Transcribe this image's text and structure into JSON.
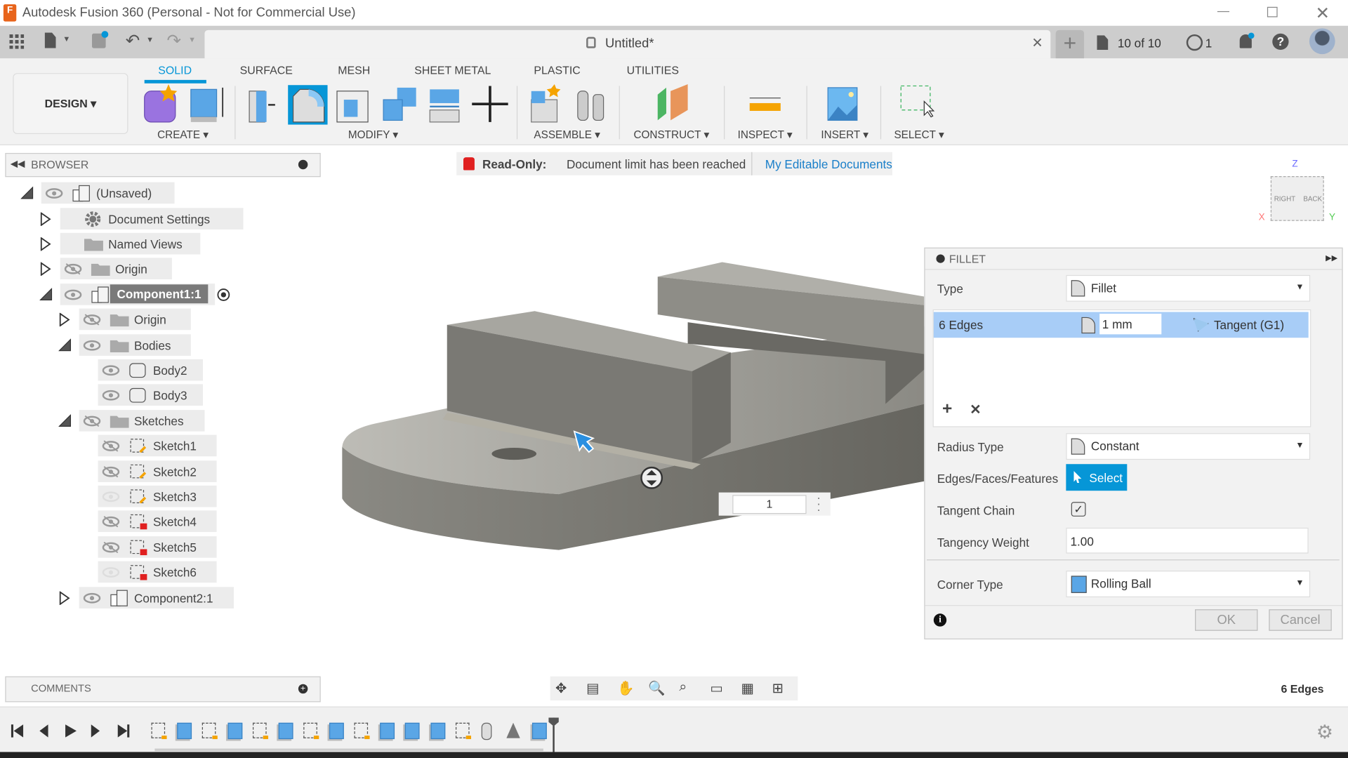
{
  "app": {
    "title": "Autodesk Fusion 360 (Personal - Not for Commercial Use)",
    "logo_letter": "F"
  },
  "window_controls": [
    "minimize",
    "restore",
    "close"
  ],
  "doc_tab": {
    "title": "Untitled*",
    "lock_icon": "lock-icon"
  },
  "header_right": {
    "job_count": "10 of 10",
    "clock_count": "1",
    "accent": "#0696d7"
  },
  "workspace": {
    "label": "DESIGN ▾"
  },
  "ribbon_tabs": [
    {
      "label": "SOLID",
      "active": true
    },
    {
      "label": "SURFACE"
    },
    {
      "label": "MESH"
    },
    {
      "label": "SHEET METAL"
    },
    {
      "label": "PLASTIC"
    },
    {
      "label": "UTILITIES"
    }
  ],
  "ribbon_groups": [
    {
      "label": "CREATE ▾"
    },
    {
      "label": "MODIFY ▾"
    },
    {
      "label": "ASSEMBLE ▾"
    },
    {
      "label": "CONSTRUCT ▾"
    },
    {
      "label": "INSPECT ▾"
    },
    {
      "label": "INSERT ▾"
    },
    {
      "label": "SELECT ▾"
    }
  ],
  "browser": {
    "title": "BROWSER",
    "items": [
      {
        "label": "(Unsaved)",
        "level": 0,
        "expand": "open",
        "eye": "on",
        "icon": "component"
      },
      {
        "label": "Document Settings",
        "level": 1,
        "expand": "closed",
        "eye": "none",
        "icon": "gear"
      },
      {
        "label": "Named Views",
        "level": 1,
        "expand": "closed",
        "eye": "none",
        "icon": "folder"
      },
      {
        "label": "Origin",
        "level": 1,
        "expand": "closed",
        "eye": "off",
        "icon": "folder"
      },
      {
        "label": "Component1:1",
        "level": 1,
        "expand": "open",
        "eye": "on",
        "icon": "component",
        "highlighted": true,
        "active": true
      },
      {
        "label": "Origin",
        "level": 2,
        "expand": "closed",
        "eye": "off",
        "icon": "folder"
      },
      {
        "label": "Bodies",
        "level": 2,
        "expand": "open",
        "eye": "on",
        "icon": "folder"
      },
      {
        "label": "Body2",
        "level": 3,
        "expand": "none",
        "eye": "on",
        "icon": "body"
      },
      {
        "label": "Body3",
        "level": 3,
        "expand": "none",
        "eye": "on",
        "icon": "body"
      },
      {
        "label": "Sketches",
        "level": 2,
        "expand": "open",
        "eye": "off",
        "icon": "folder"
      },
      {
        "label": "Sketch1",
        "level": 3,
        "expand": "none",
        "eye": "off",
        "icon": "sketch"
      },
      {
        "label": "Sketch2",
        "level": 3,
        "expand": "none",
        "eye": "off",
        "icon": "sketch"
      },
      {
        "label": "Sketch3",
        "level": 3,
        "expand": "none",
        "eye": "dim",
        "icon": "sketch"
      },
      {
        "label": "Sketch4",
        "level": 3,
        "expand": "none",
        "eye": "off",
        "icon": "sketch-locked"
      },
      {
        "label": "Sketch5",
        "level": 3,
        "expand": "none",
        "eye": "off",
        "icon": "sketch-locked"
      },
      {
        "label": "Sketch6",
        "level": 3,
        "expand": "none",
        "eye": "dim",
        "icon": "sketch-locked"
      },
      {
        "label": "Component2:1",
        "level": 2,
        "expand": "closed",
        "eye": "on",
        "icon": "component-link"
      }
    ]
  },
  "banner": {
    "label": "Read-Only:",
    "message": "Document limit has been reached",
    "link": "My Editable Documents",
    "lock_color": "#e02020"
  },
  "viewcube": {
    "faces": [
      "RIGHT",
      "BACK"
    ],
    "axes": [
      "X",
      "Y",
      "Z"
    ]
  },
  "viewport": {
    "input_value": "1"
  },
  "fillet": {
    "title": "FILLET",
    "type_label": "Type",
    "type_value": "Fillet",
    "edges_label": "6 Edges",
    "radius_value": "1 mm",
    "continuity": "Tangent (G1)",
    "radius_type_label": "Radius Type",
    "radius_type_value": "Constant",
    "eff_label": "Edges/Faces/Features",
    "select_label": "Select",
    "tangent_chain_label": "Tangent Chain",
    "tangent_chain_checked": true,
    "tangency_weight_label": "Tangency Weight",
    "tangency_weight_value": "1.00",
    "corner_type_label": "Corner Type",
    "corner_type_value": "Rolling Ball",
    "ok_label": "OK",
    "cancel_label": "Cancel",
    "highlight_color": "#a8cdf7"
  },
  "comments": {
    "title": "COMMENTS"
  },
  "nav_tools": [
    "orbit",
    "look-at",
    "pan",
    "zoom",
    "zoom-window",
    "display-settings",
    "grid",
    "viewports"
  ],
  "status": {
    "selection": "6 Edges"
  },
  "timeline": {
    "items": [
      "sketch",
      "extrude",
      "sketch",
      "extrude",
      "sketch",
      "extrude",
      "sketch",
      "extrude",
      "sketch",
      "extrude",
      "extrude",
      "extrude",
      "sketch",
      "joint",
      "mirror",
      "fillet"
    ]
  }
}
